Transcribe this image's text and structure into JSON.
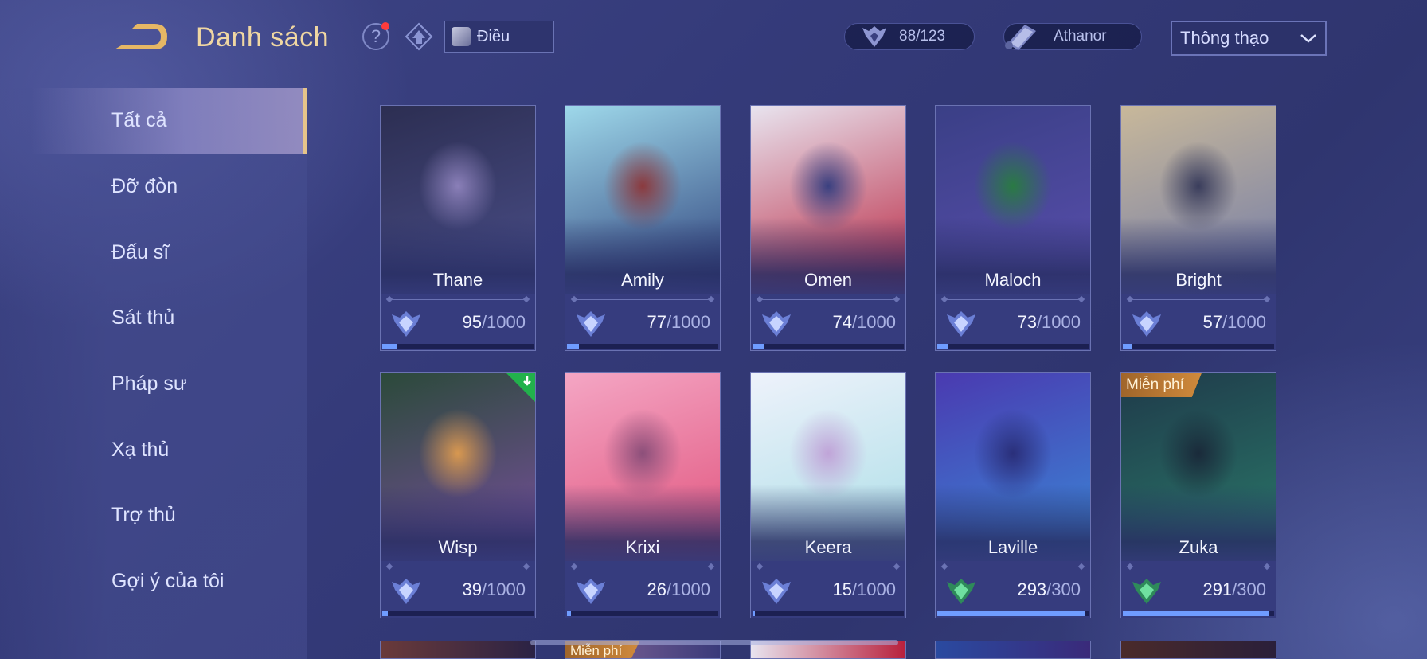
{
  "header": {
    "title": "Danh sách",
    "search_value": "Điều",
    "heroes_owned": "88/123",
    "arcana_label": "Athanor",
    "sort_selected": "Thông thạo"
  },
  "sidebar": {
    "items": [
      {
        "label": "Tất cả",
        "active": true
      },
      {
        "label": "Đỡ đòn"
      },
      {
        "label": "Đấu sĩ"
      },
      {
        "label": "Sát thủ"
      },
      {
        "label": "Pháp sư"
      },
      {
        "label": "Xạ thủ"
      },
      {
        "label": "Trợ thủ"
      },
      {
        "label": "Gợi ý của tôi"
      }
    ]
  },
  "heroes": [
    {
      "name": "Thane",
      "points": "95",
      "max": "/1000",
      "progress": 0.095,
      "mastery": "silver",
      "colors": [
        "#2c2e52",
        "#4b4f8a",
        "#8a7fb8"
      ]
    },
    {
      "name": "Amily",
      "points": "77",
      "max": "/1000",
      "progress": 0.077,
      "mastery": "silver",
      "colors": [
        "#9ed8ea",
        "#2a3c78",
        "#8b3a3e"
      ]
    },
    {
      "name": "Omen",
      "points": "74",
      "max": "/1000",
      "progress": 0.074,
      "mastery": "silver",
      "colors": [
        "#e8e4ef",
        "#b8203c",
        "#3a4080"
      ]
    },
    {
      "name": "Maloch",
      "points": "73",
      "max": "/1000",
      "progress": 0.073,
      "mastery": "silver",
      "colors": [
        "#3a3f86",
        "#5a4fae",
        "#2a7a44"
      ]
    },
    {
      "name": "Bright",
      "points": "57",
      "max": "/1000",
      "progress": 0.057,
      "mastery": "silver",
      "colors": [
        "#c8b89a",
        "#707aa8",
        "#3a3d5c"
      ]
    },
    {
      "name": "Wisp",
      "points": "39",
      "max": "/1000",
      "progress": 0.039,
      "mastery": "silver",
      "colors": [
        "#2b4a3a",
        "#7a4fa0",
        "#d89850"
      ],
      "download": true
    },
    {
      "name": "Krixi",
      "points": "26",
      "max": "/1000",
      "progress": 0.026,
      "mastery": "silver",
      "colors": [
        "#f4a6c4",
        "#e0507a",
        "#8c4f7a"
      ]
    },
    {
      "name": "Keera",
      "points": "15",
      "max": "/1000",
      "progress": 0.015,
      "mastery": "silver",
      "colors": [
        "#eef2fb",
        "#a8dde6",
        "#c0a4d8"
      ]
    },
    {
      "name": "Laville",
      "points": "293",
      "max": "/300",
      "progress": 0.977,
      "mastery": "green",
      "colors": [
        "#4a3ab0",
        "#3a8ad8",
        "#2a2f7a"
      ]
    },
    {
      "name": "Zuka",
      "points": "291",
      "max": "/300",
      "progress": 0.97,
      "mastery": "green",
      "colors": [
        "#1f3a4a",
        "#2a7a6a",
        "#1a2a3a"
      ],
      "badge": "Miễn phí"
    }
  ],
  "peek_badge": "Miễn phí",
  "colors": {
    "accent_gold": "#e6c48a",
    "progress_blue": "#6f9cff",
    "background": "#343a79"
  }
}
